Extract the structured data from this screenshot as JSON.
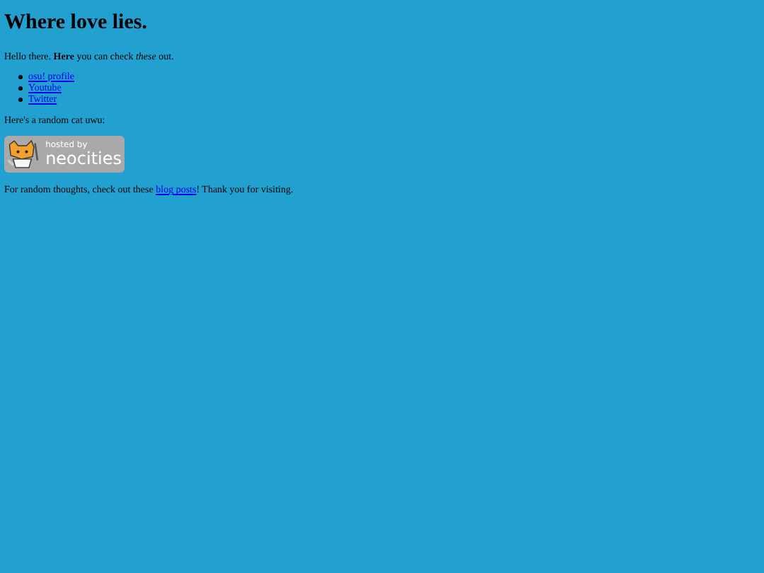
{
  "title": "Where love lies.",
  "intro": "Hello there. **Here** you can check *these* out.",
  "links": [
    {
      "label": "osu! profile"
    },
    {
      "label": "Youtube"
    },
    {
      "label": "Twitter"
    }
  ],
  "cat_caption": "Here's a random cat uwu:",
  "badge": {
    "line_1": "hosted by",
    "line_2": "neocities"
  },
  "footer": {
    "before": "For random thoughts, check out these ",
    "link": "blog posts",
    "after": "! Thank you for visiting."
  }
}
